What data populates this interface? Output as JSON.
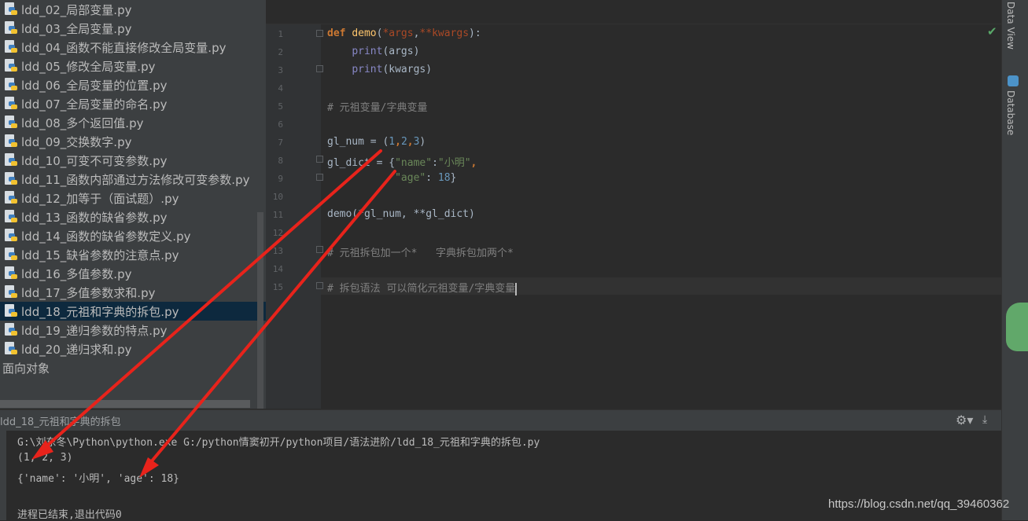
{
  "project_tree": {
    "files": [
      "ldd_02_局部变量.py",
      "ldd_03_全局变量.py",
      "ldd_04_函数不能直接修改全局变量.py",
      "ldd_05_修改全局变量.py",
      "ldd_06_全局变量的位置.py",
      "ldd_07_全局变量的命名.py",
      "ldd_08_多个返回值.py",
      "ldd_09_交换数字.py",
      "ldd_10_可变不可变参数.py",
      "ldd_11_函数内部通过方法修改可变参数.py",
      "ldd_12_加等于（面试题）.py",
      "ldd_13_函数的缺省参数.py",
      "ldd_14_函数的缺省参数定义.py",
      "ldd_15_缺省参数的注意点.py",
      "ldd_16_多值参数.py",
      "ldd_17_多值参数求和.py",
      "ldd_18_元祖和字典的拆包.py",
      "ldd_19_递归参数的特点.py",
      "ldd_20_递归求和.py"
    ],
    "selected_index": 16,
    "folder": "面向对象"
  },
  "editor": {
    "line_numbers": [
      "1",
      "2",
      "3",
      "4",
      "5",
      "6",
      "7",
      "8",
      "9",
      "10",
      "11",
      "12",
      "13",
      "14",
      "15"
    ],
    "lines": {
      "l1_kw": "def",
      "l1_fn": "demo",
      "l1_a": "(",
      "l1_p1": "*args",
      "l1_b": ",",
      "l1_p2": "**kwargs",
      "l1_c": "):",
      "l2_bi": "print",
      "l2_rest": "(args)",
      "l3_bi": "print",
      "l3_rest": "(kwargs)",
      "l5_cm": "# 元祖变量/字典变量",
      "l7_a": "gl_num = (",
      "l7_n1": "1",
      "l7_c1": ",",
      "l7_n2": "2",
      "l7_c2": ",",
      "l7_n3": "3",
      "l7_b": ")",
      "l8_a": "gl_dict = {",
      "l8_s1": "\"name\"",
      "l8_b": ":",
      "l8_s2": "\"小明\"",
      "l8_c": ",",
      "l9_s1": "\"age\"",
      "l9_b": ": ",
      "l9_n": "18",
      "l9_c": "}",
      "l11": "demo(*gl_num, **gl_dict)",
      "l13_cm": "# 元祖拆包加一个*   字典拆包加两个*",
      "l15_cm": "# 拆包语法 可以简化元祖变量/字典变量"
    }
  },
  "right_strip": {
    "tab1": "Data View",
    "tab2": "Database"
  },
  "run_panel": {
    "title": "ldd_18_元祖和字典的拆包",
    "output": [
      "G:\\刘东冬\\Python\\python.exe G:/python情窦初开/python项目/语法进阶/ldd_18_元祖和字典的拆包.py",
      "(1, 2, 3)",
      "{'name': '小明', 'age': 18}",
      "",
      "进程已结束,退出代码0"
    ]
  },
  "watermark": "https://blog.csdn.net/qq_39460362",
  "colors": {
    "arrow": "#e8231b",
    "selected_row": "#0d293e",
    "keyword": "#cc7832",
    "string": "#6a8759",
    "number": "#6897bb",
    "comment": "#808080"
  }
}
